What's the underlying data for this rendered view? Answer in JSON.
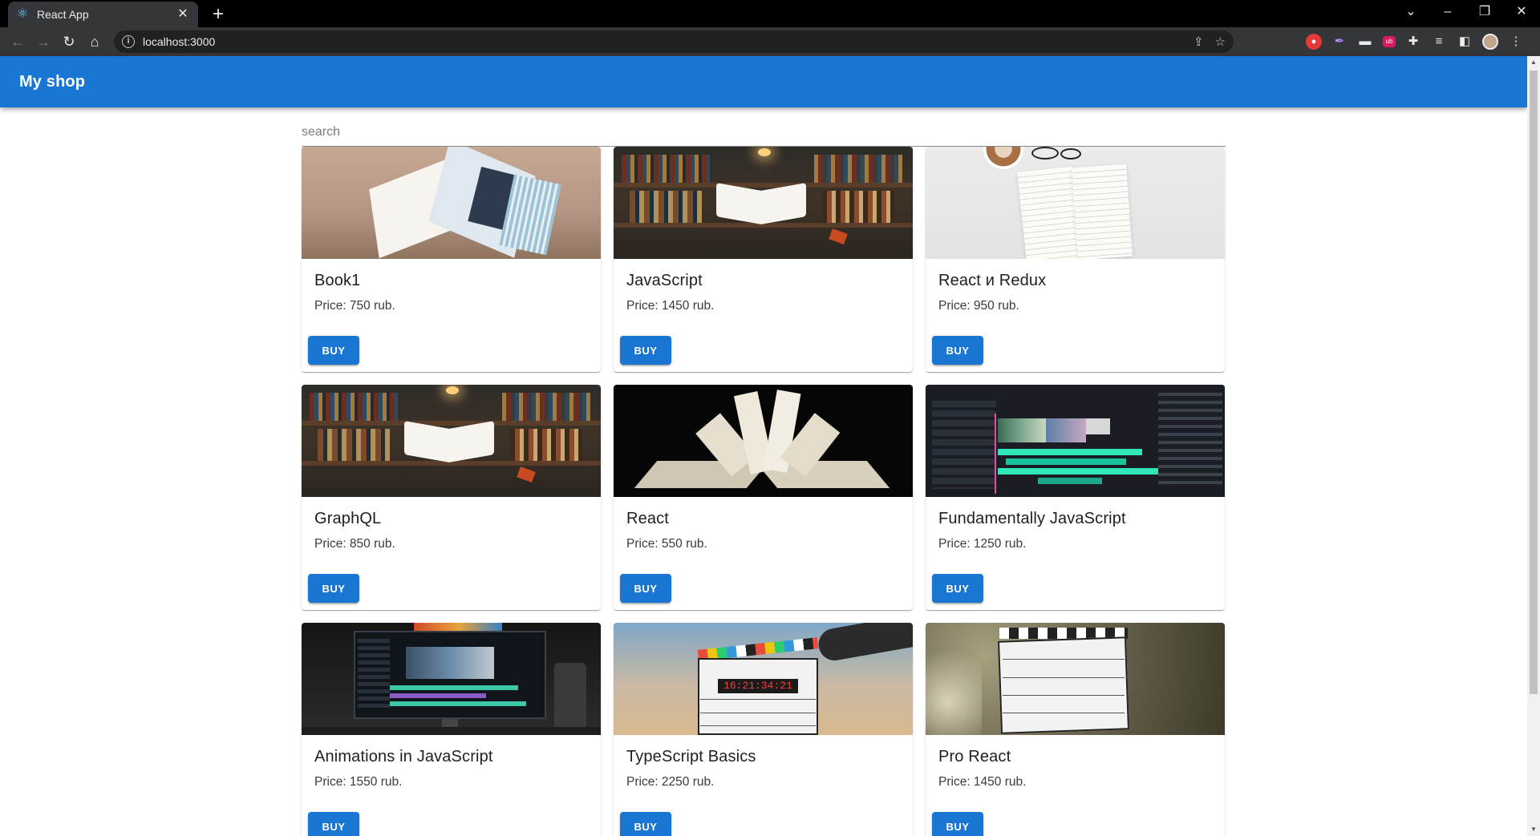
{
  "browser": {
    "tab_title": "React App",
    "url": "localhost:3000"
  },
  "app": {
    "title": "My shop"
  },
  "search": {
    "placeholder": "search",
    "value": ""
  },
  "products": [
    {
      "title": "Book1",
      "price": "Price: 750 rub.",
      "buy_label": "BUY",
      "image": "open-book-flipping-pages"
    },
    {
      "title": "JavaScript",
      "price": "Price: 1450 rub.",
      "buy_label": "BUY",
      "image": "floating-book-library"
    },
    {
      "title": "React и Redux",
      "price": "Price: 950 rub.",
      "buy_label": "BUY",
      "image": "open-book-coffee-glasses"
    },
    {
      "title": "GraphQL",
      "price": "Price: 850 rub.",
      "buy_label": "BUY",
      "image": "floating-book-library"
    },
    {
      "title": "React",
      "price": "Price: 550 rub.",
      "buy_label": "BUY",
      "image": "fanned-book-pages-dark"
    },
    {
      "title": "Fundamentally JavaScript",
      "price": "Price: 1250 rub.",
      "buy_label": "BUY",
      "image": "video-editor-timeline"
    },
    {
      "title": "Animations in JavaScript",
      "price": "Price: 1550 rub.",
      "buy_label": "BUY",
      "image": "monitor-video-editing"
    },
    {
      "title": "TypeScript Basics",
      "price": "Price: 2250 rub.",
      "buy_label": "BUY",
      "image": "film-clapperboard-desert"
    },
    {
      "title": "Pro React",
      "price": "Price: 1450 rub.",
      "buy_label": "BUY",
      "image": "film-clapperboard-handwritten"
    }
  ],
  "colors": {
    "primary": "#1976d2",
    "browser_frame": "#35363a"
  }
}
